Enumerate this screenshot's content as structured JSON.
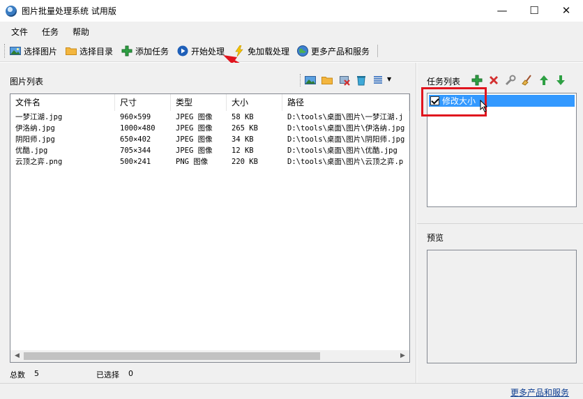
{
  "window": {
    "title": "图片批量处理系统 试用版",
    "controls": {
      "minimize": "—",
      "maximize": "☐",
      "close": "✕"
    }
  },
  "menu": [
    "文件",
    "任务",
    "帮助"
  ],
  "toolbar": {
    "select_image": "选择图片",
    "select_dir": "选择目录",
    "add_task": "添加任务",
    "start": "开始处理",
    "no_load": "免加载处理",
    "more_products": "更多产品和服务"
  },
  "image_list": {
    "title": "图片列表",
    "columns": [
      "文件名",
      "尺寸",
      "类型",
      "大小",
      "路径"
    ],
    "rows": [
      {
        "name": "一梦江湖.jpg",
        "size": "960×599",
        "type": "JPEG 图像",
        "bytes": "58 KB",
        "path": "D:\\tools\\桌面\\图片\\一梦江湖.j"
      },
      {
        "name": "伊洛纳.jpg",
        "size": "1000×480",
        "type": "JPEG 图像",
        "bytes": "265 KB",
        "path": "D:\\tools\\桌面\\图片\\伊洛纳.jpg"
      },
      {
        "name": "阴阳师.jpg",
        "size": "650×402",
        "type": "JPEG 图像",
        "bytes": "34 KB",
        "path": "D:\\tools\\桌面\\图片\\阴阳师.jpg"
      },
      {
        "name": "优酷.jpg",
        "size": "705×344",
        "type": "JPEG 图像",
        "bytes": "12 KB",
        "path": "D:\\tools\\桌面\\图片\\优酷.jpg"
      },
      {
        "name": "云顶之弈.png",
        "size": "500×241",
        "type": "PNG 图像",
        "bytes": "220 KB",
        "path": "D:\\tools\\桌面\\图片\\云顶之弈.p"
      }
    ]
  },
  "status": {
    "total_label": "总数",
    "total": "5",
    "selected_label": "已选择",
    "selected": "0"
  },
  "task_list": {
    "title": "任务列表",
    "items": [
      {
        "label": "修改大小",
        "checked": true
      }
    ]
  },
  "preview": {
    "title": "预览"
  },
  "footer": {
    "more_link": "更多产品和服务"
  },
  "colors": {
    "selection": "#3399ff",
    "annotation": "#e0141e",
    "panel": "#f0f0f0"
  }
}
